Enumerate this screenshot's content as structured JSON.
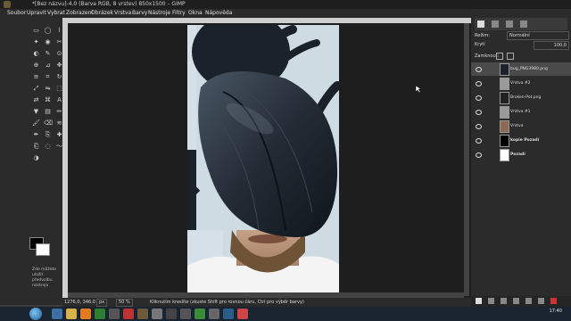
{
  "window": {
    "title": "*[Bez názvu]-4.0 (Barva RGB, 8 vrstev) 850x1500 – GIMP"
  },
  "menubar": [
    "Soubor",
    "Upravit",
    "Vybrat",
    "Zobrazení",
    "Obrázek",
    "Vrstva",
    "Barvy",
    "Nástroje",
    "Filtry",
    "Okna",
    "Nápověda"
  ],
  "toolbox": {
    "tool_options_text": "Zde můžete uložit předvolbu nástroje",
    "tools": [
      "rect-select",
      "ellipse-select",
      "free-select",
      "fuzzy-select",
      "color-select",
      "scissors",
      "foreground-select",
      "paths",
      "color-picker",
      "zoom",
      "measure",
      "move",
      "align",
      "crop",
      "rotate",
      "scale",
      "shear",
      "perspective",
      "flip",
      "cage",
      "text",
      "bucket-fill",
      "blend",
      "pencil",
      "paintbrush",
      "eraser",
      "airbrush",
      "ink",
      "clone",
      "heal",
      "perspective-clone",
      "blur",
      "smudge",
      "dodge-burn"
    ]
  },
  "statusbar": {
    "coords": "1276,0, 346,0",
    "unit": "px",
    "zoom": "50 %",
    "message": "Kliknutím kreslíte (zkuste Shift pro rovnou čáru, Ctrl pro výběr barvy)"
  },
  "layers_dock": {
    "mode_label": "Režim:",
    "mode_value": "Normální",
    "opacity_label": "Krytí",
    "opacity_value": "100,0",
    "lock_label": "Zamknout:",
    "layers": [
      {
        "name": "bug_PNG3980.png",
        "thumb_color": "#1b222b",
        "bold": false
      },
      {
        "name": "Vrstva #2",
        "thumb_color": "#9a9a9a",
        "bold": false
      },
      {
        "name": "Broken-Pot.png",
        "thumb_color": "#222222",
        "bold": false
      },
      {
        "name": "Vrstva #1",
        "thumb_color": "#9a9a9a",
        "bold": false
      },
      {
        "name": "Vrstva",
        "thumb_color": "#8c6a55",
        "bold": false
      },
      {
        "name": "kopie Pozadí",
        "thumb_color": "#000000",
        "bold": true
      },
      {
        "name": "Pozadí",
        "thumb_color": "#ffffff",
        "bold": true
      }
    ]
  },
  "taskbar": {
    "time": "17:40"
  },
  "colors": {
    "canvas_bg": "#1e1e1e",
    "panel_bg": "#2b2b2b",
    "selected_layer": "#4a4a4a"
  }
}
